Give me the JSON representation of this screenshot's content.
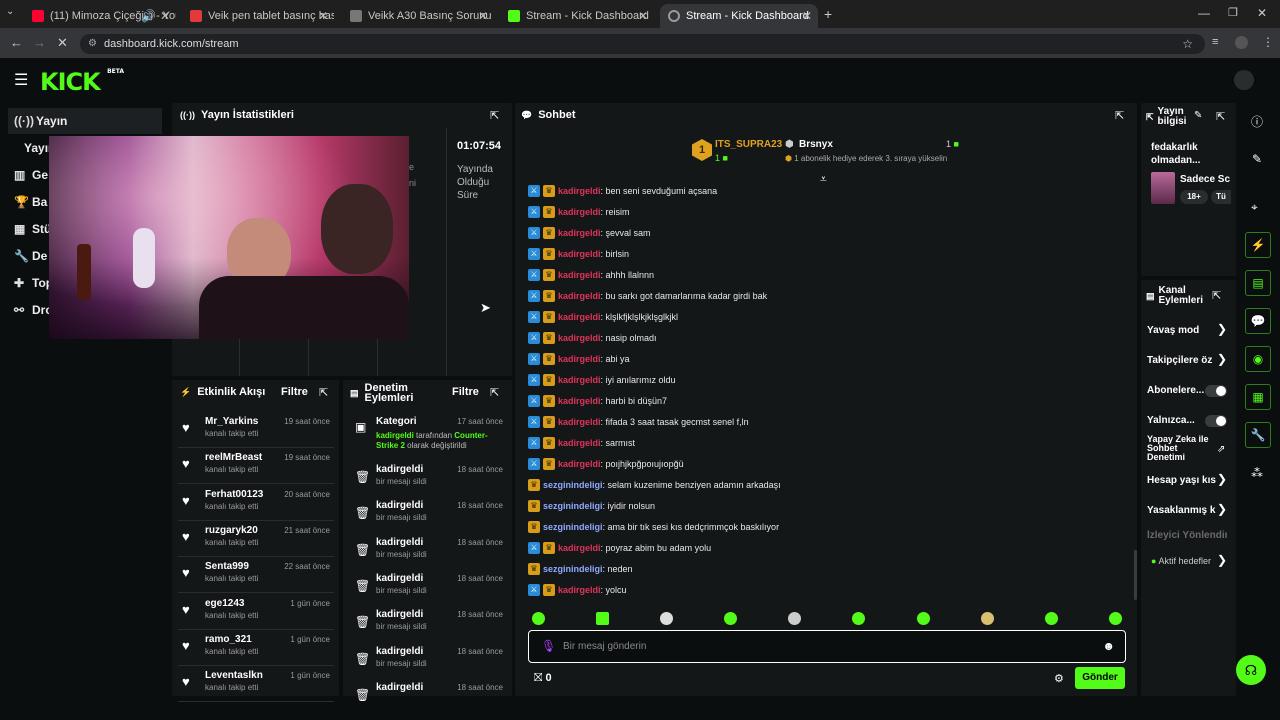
{
  "browser": {
    "tabs": [
      {
        "title": "(11) Mimoza Çiçeğim - You",
        "fav": "#ff0033"
      },
      {
        "title": "Veik pen tablet basınç hassasiy",
        "fav": "#e23a3a"
      },
      {
        "title": "Veikk A30 Basınç Sorunu",
        "fav": "#777777"
      },
      {
        "title": "Stream - Kick Dashboard",
        "fav": "#53fc18"
      },
      {
        "title": "Stream - Kick Dashboard",
        "fav": "#9a9a9a"
      }
    ],
    "url": "dashboard.kick.com/stream"
  },
  "logo": "KICK",
  "logo_beta": "BETA",
  "sidebar": {
    "items": [
      {
        "label": "Yayın",
        "icon": "broadcast-icon"
      },
      {
        "label": "Yayın",
        "icon": ""
      },
      {
        "label": "Ge",
        "icon": "chart-icon"
      },
      {
        "label": "Ba",
        "icon": "trophy-icon"
      },
      {
        "label": "Stü",
        "icon": "grid-icon"
      },
      {
        "label": "De",
        "icon": "wrench-icon"
      },
      {
        "label": "Top",
        "icon": "puzzle-icon"
      },
      {
        "label": "Dro",
        "icon": "drops-icon"
      }
    ]
  },
  "stats": {
    "title": "Yayın İstatistikleri",
    "uptime_value": "01:07:54",
    "uptime_label_1": "Yayında",
    "uptime_label_2": "Olduğu",
    "uptime_label_3": "Süre",
    "hidden_1": "e",
    "hidden_2": "ni"
  },
  "activity": {
    "title": "Etkinlik Akışı",
    "filter": "Filtre",
    "items": [
      {
        "name": "Mr_Yarkins",
        "sub": "kanalı takip etti",
        "time": "19 saat önce"
      },
      {
        "name": "reelMrBeast",
        "sub": "kanalı takip etti",
        "time": "19 saat önce"
      },
      {
        "name": "Ferhat00123",
        "sub": "kanalı takip etti",
        "time": "20 saat önce"
      },
      {
        "name": "ruzgaryk20",
        "sub": "kanalı takip etti",
        "time": "21 saat önce"
      },
      {
        "name": "Senta999",
        "sub": "kanalı takip etti",
        "time": "22 saat önce"
      },
      {
        "name": "ege1243",
        "sub": "kanalı takip etti",
        "time": "1 gün önce"
      },
      {
        "name": "ramo_321",
        "sub": "kanalı takip etti",
        "time": "1 gün önce"
      },
      {
        "name": "Leventaslkn",
        "sub": "kanalı takip etti",
        "time": "1 gün önce"
      }
    ]
  },
  "moderation": {
    "title_1": "Denetim",
    "title_2": "Eylemleri",
    "filter": "Filtre",
    "category": {
      "name": "Kategori",
      "time": "17 saat önce",
      "user": "kadirgeldi",
      "text_1": " tarafından ",
      "game": "Counter-",
      "game_2": "Strike 2",
      "text_2": " olarak değiştirildi"
    },
    "items": [
      {
        "name": "kadirgeldi",
        "sub": "bir mesajı sildi",
        "time": "18 saat önce"
      },
      {
        "name": "kadirgeldi",
        "sub": "bir mesajı sildi",
        "time": "18 saat önce"
      },
      {
        "name": "kadirgeldi",
        "sub": "bir mesajı sildi",
        "time": "18 saat önce"
      },
      {
        "name": "kadirgeldi",
        "sub": "bir mesajı sildi",
        "time": "18 saat önce"
      },
      {
        "name": "kadirgeldi",
        "sub": "bir mesajı sildi",
        "time": "18 saat önce"
      },
      {
        "name": "kadirgeldi",
        "sub": "bir mesajı sildi",
        "time": "18 saat önce"
      },
      {
        "name": "kadirgeldi",
        "sub": "",
        "time": "18 saat önce"
      }
    ]
  },
  "chat": {
    "title": "Sohbet",
    "leader_1": {
      "rank": "1",
      "name": "ITS_SUPRA23",
      "count": "1"
    },
    "leader_2": {
      "name": "Brsnyx",
      "count": "1",
      "sub": "1 abonelik hediye ederek 3. sıraya yükselin"
    },
    "messages": [
      {
        "user": "kadirgeldi",
        "text": ": ben seni sevduğumi açsana",
        "color": "red",
        "mod": true
      },
      {
        "user": "kadirgeldi",
        "text": ": reisim",
        "color": "red",
        "mod": true
      },
      {
        "user": "kadirgeldi",
        "text": ": şevval sam",
        "color": "red",
        "mod": true
      },
      {
        "user": "kadirgeldi",
        "text": ": birlsin",
        "color": "red",
        "mod": true
      },
      {
        "user": "kadirgeldi",
        "text": ": ahhh llalnnn",
        "color": "red",
        "mod": true
      },
      {
        "user": "kadirgeldi",
        "text": ": bu sarkı got damarlarıma kadar girdi bak",
        "color": "red",
        "mod": true
      },
      {
        "user": "kadirgeldi",
        "text": ": klşlkfjklşlkjklşglkjkl",
        "color": "red",
        "mod": true
      },
      {
        "user": "kadirgeldi",
        "text": ": nasip olmadı",
        "color": "red",
        "mod": true
      },
      {
        "user": "kadirgeldi",
        "text": ": abi ya",
        "color": "red",
        "mod": true
      },
      {
        "user": "kadirgeldi",
        "text": ": iyi anılarımız oldu",
        "color": "red",
        "mod": true
      },
      {
        "user": "kadirgeldi",
        "text": ": harbi bi düşün7",
        "color": "red",
        "mod": true
      },
      {
        "user": "kadirgeldi",
        "text": ": fifada 3 saat tasak gecmst senel f,ln",
        "color": "red",
        "mod": true
      },
      {
        "user": "kadirgeldi",
        "text": ": sarmıst",
        "color": "red",
        "mod": true
      },
      {
        "user": "kadirgeldi",
        "text": ": poıjhjkpğpoıujıopğü",
        "color": "red",
        "mod": true
      },
      {
        "user": "sezginindeligi",
        "text": ": selam kuzenime benziyen adamın arkadaşı",
        "color": "blue",
        "mod": false
      },
      {
        "user": "sezginindeligi",
        "text": ": iyidir nolsun",
        "color": "blue",
        "mod": false
      },
      {
        "user": "sezginindeligi",
        "text": ": ama bir tık sesi kıs dedçrimmçok baskılıyor",
        "color": "blue",
        "mod": false
      },
      {
        "user": "kadirgeldi",
        "text": ": poyraz abim bu adam yolu",
        "color": "red",
        "mod": true
      },
      {
        "user": "sezginindeligi",
        "text": ": neden",
        "color": "blue",
        "mod": false
      },
      {
        "user": "kadirgeldi",
        "text": ": yolcu",
        "color": "red",
        "mod": true
      }
    ],
    "placeholder": "Bir mesaj gönderin",
    "points": "0",
    "send": "Gönder"
  },
  "stream_info": {
    "title_1": "Yayın",
    "title_2": "bilgisi",
    "desc_1": "fedakarlık",
    "desc_2": "olmadan...",
    "category": "Sadece Sc",
    "tag_1": "18+",
    "tag_2": "Tü"
  },
  "channel_actions": {
    "title_1": "Kanal",
    "title_2": "Eylemleri",
    "items": [
      {
        "label": "Yavaş mod",
        "type": "chevron"
      },
      {
        "label": "Takipçilere öz",
        "type": "chevron"
      },
      {
        "label": "Abonelere...",
        "type": "toggle"
      },
      {
        "label": "Yalnızca...",
        "type": "toggle"
      },
      {
        "label": "Yapay Zeka ile Sohbet Denetimi",
        "type": "link"
      },
      {
        "label": "Hesap yaşı kıs",
        "type": "chevron"
      },
      {
        "label": "Yasaklanmış k",
        "type": "chevron"
      },
      {
        "label": "İzleyici Yönlendir",
        "type": "disabled"
      },
      {
        "label": "Aktif hedefler",
        "type": "chevron"
      }
    ]
  },
  "colors": {
    "accent": "#53fc18",
    "panel": "#141718",
    "bg": "#0b0e0f"
  }
}
